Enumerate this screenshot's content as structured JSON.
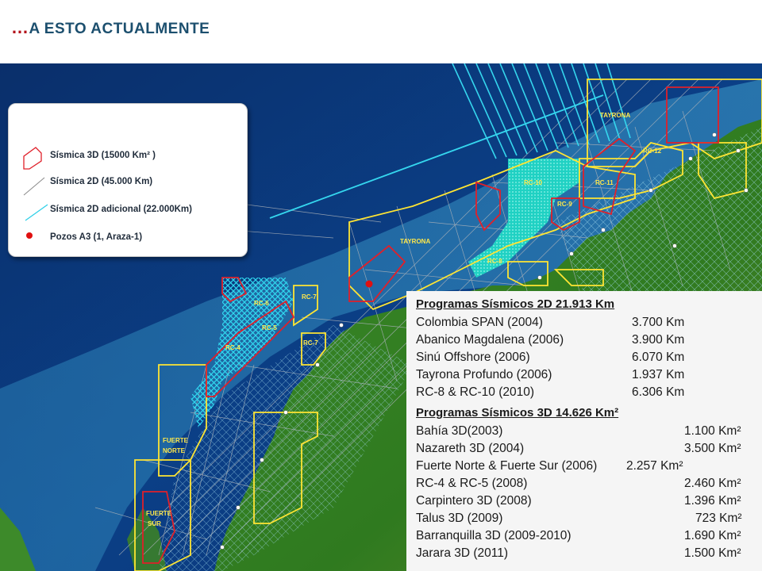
{
  "title": {
    "prefix": "…",
    "text": "A ESTO ACTUALMENTE"
  },
  "legend": {
    "items": [
      {
        "label": "Sísmica 3D (15000  Km² )",
        "color": "#e0202a"
      },
      {
        "label": "Sísmica 2D (45.000  Km)",
        "color": "#8a8a8a"
      },
      {
        "label": "Sísmica 2D adicional (22.000Km)",
        "color": "#2fd0e8"
      },
      {
        "label": "Pozos A3 (1, Araza-1)",
        "color": "#e01010"
      }
    ]
  },
  "map_labels": {
    "tayrona_n": "TAYRONA",
    "rc12": "RC-12",
    "rc10": "RC-10",
    "rc11": "RC-11",
    "rc9": "RC-9",
    "tayrona_s": "TAYRONA",
    "rc8": "RC-8",
    "rc7a": "RC-7",
    "rc6": "RC-6",
    "rc5": "RC-5",
    "rc4": "RC-4",
    "rc7b": "RC-7",
    "fuerte_norte_1": "FUERTE",
    "fuerte_norte_2": "NORTE",
    "fuerte_sur_1": "FUERTE",
    "fuerte_sur_2": "SUR"
  },
  "programs_2d": {
    "header": "Programas Sísmicos 2D   21.913 Km",
    "rows": [
      {
        "name": "Colombia SPAN (2004)",
        "value": "3.700 Km"
      },
      {
        "name": "Abanico Magdalena (2006)",
        "value": "3.900 Km"
      },
      {
        "name": "Sinú Offshore (2006)",
        "value": "6.070 Km"
      },
      {
        "name": "Tayrona Profundo (2006)",
        "value": "1.937 Km"
      },
      {
        "name": "RC-8 & RC-10 (2010)",
        "value": "6.306 Km"
      }
    ]
  },
  "programs_3d": {
    "header": "Programas Sísmicos 3D  14.626 Km²",
    "rows": [
      {
        "name": "Bahía 3D(2003)",
        "value": "1.100 Km²"
      },
      {
        "name": "Nazareth 3D (2004)",
        "value": "3.500 Km²"
      },
      {
        "name": "Fuerte Norte & Fuerte Sur (2006)",
        "value": "2.257 Km²"
      },
      {
        "name": "RC-4 & RC-5 (2008)",
        "value": "2.460 Km²"
      },
      {
        "name": "Carpintero 3D (2008)",
        "value": "1.396 Km²"
      },
      {
        "name": "Talus 3D (2009)",
        "value": "723 Km²"
      },
      {
        "name": "Barranquilla 3D (2009-2010)",
        "value": "1.690 Km²"
      },
      {
        "name": "Jarara 3D (2011)",
        "value": "1.500 Km²"
      }
    ]
  }
}
